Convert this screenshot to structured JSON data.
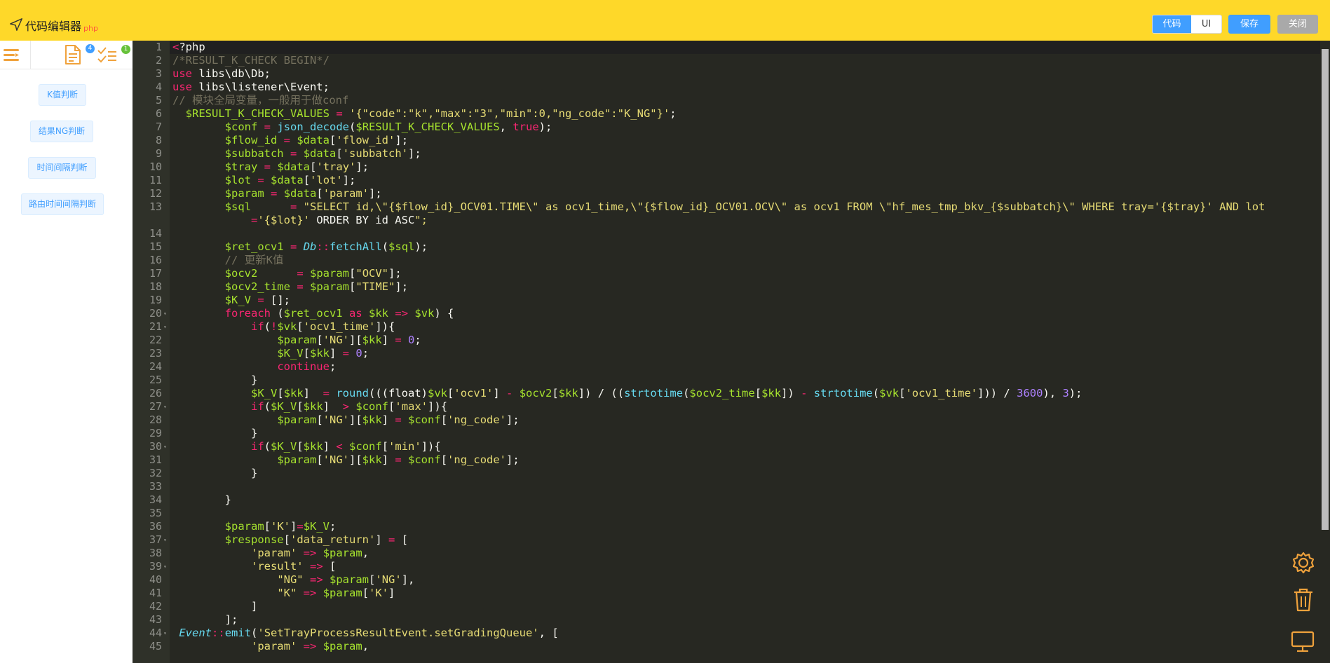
{
  "header": {
    "title": "代码编辑器",
    "lang": "php",
    "mode_tabs": [
      "代码",
      "UI"
    ],
    "save_label": "保存",
    "close_label": "关闭",
    "accent": "#409eff",
    "bar_color": "#fed829"
  },
  "sidebar": {
    "doc_badge": "4",
    "check_badge": "1",
    "items": [
      "K值判断",
      "结果NG判断",
      "时间间隔判断",
      "路由时间间隔判断"
    ]
  },
  "editor": {
    "theme_bg": "#272822",
    "lines": [
      {
        "n": "1",
        "code": "<?php"
      },
      {
        "n": "2",
        "code": "/*RESULT_K_CHECK BEGIN*/"
      },
      {
        "n": "3",
        "code": "use libs\\db\\Db;"
      },
      {
        "n": "4",
        "code": "use libs\\listener\\Event;"
      },
      {
        "n": "5",
        "code": "// 模块全局变量，一般用于做conf"
      },
      {
        "n": "6",
        "code": "  $RESULT_K_CHECK_VALUES = '{\"code\":\"k\",\"max\":\"3\",\"min\":0,\"ng_code\":\"K_NG\"}';"
      },
      {
        "n": "7",
        "code": "        $conf = json_decode($RESULT_K_CHECK_VALUES, true);"
      },
      {
        "n": "8",
        "code": "        $flow_id = $data['flow_id'];"
      },
      {
        "n": "9",
        "code": "        $subbatch = $data['subbatch'];"
      },
      {
        "n": "10",
        "code": "        $tray = $data['tray'];"
      },
      {
        "n": "11",
        "code": "        $lot = $data['lot'];"
      },
      {
        "n": "12",
        "code": "        $param = $data['param'];"
      },
      {
        "n": "13",
        "code": "        $sql      = \"SELECT id,\\\"{$flow_id}_OCV01.TIME\\\" as ocv1_time,\\\"{$flow_id}_OCV01.OCV\\\" as ocv1 FROM \\\"hf_mes_tmp_bkv_{$subbatch}\\\" WHERE tray='{$tray}' AND lot"
      },
      {
        "n": "",
        "code": "            ='{$lot}' ORDER BY id ASC\";"
      },
      {
        "n": "14",
        "code": ""
      },
      {
        "n": "15",
        "code": "        $ret_ocv1 = Db::fetchAll($sql);"
      },
      {
        "n": "16",
        "code": "        // 更新K值"
      },
      {
        "n": "17",
        "code": "        $ocv2      = $param[\"OCV\"];"
      },
      {
        "n": "18",
        "code": "        $ocv2_time = $param[\"TIME\"];"
      },
      {
        "n": "19",
        "code": "        $K_V = [];"
      },
      {
        "n": "20",
        "code": "        foreach ($ret_ocv1 as $kk => $vk) {"
      },
      {
        "n": "21",
        "code": "            if(!$vk['ocv1_time']){"
      },
      {
        "n": "22",
        "code": "                $param['NG'][$kk] = 0;"
      },
      {
        "n": "23",
        "code": "                $K_V[$kk] = 0;"
      },
      {
        "n": "24",
        "code": "                continue;"
      },
      {
        "n": "25",
        "code": "            }"
      },
      {
        "n": "26",
        "code": "            $K_V[$kk]  = round(((float)$vk['ocv1'] - $ocv2[$kk]) / ((strtotime($ocv2_time[$kk]) - strtotime($vk['ocv1_time'])) / 3600), 3);"
      },
      {
        "n": "27",
        "code": "            if($K_V[$kk]  > $conf['max']){"
      },
      {
        "n": "28",
        "code": "                $param['NG'][$kk] = $conf['ng_code'];"
      },
      {
        "n": "29",
        "code": "            }"
      },
      {
        "n": "30",
        "code": "            if($K_V[$kk] < $conf['min']){"
      },
      {
        "n": "31",
        "code": "                $param['NG'][$kk] = $conf['ng_code'];"
      },
      {
        "n": "32",
        "code": "            }"
      },
      {
        "n": "33",
        "code": ""
      },
      {
        "n": "34",
        "code": "        }"
      },
      {
        "n": "35",
        "code": ""
      },
      {
        "n": "36",
        "code": "        $param['K']=$K_V;"
      },
      {
        "n": "37",
        "code": "        $response['data_return'] = ["
      },
      {
        "n": "38",
        "code": "            'param' => $param,"
      },
      {
        "n": "39",
        "code": "            'result' => ["
      },
      {
        "n": "40",
        "code": "                \"NG\" => $param['NG'],"
      },
      {
        "n": "41",
        "code": "                \"K\" => $param['K']"
      },
      {
        "n": "42",
        "code": "            ]"
      },
      {
        "n": "43",
        "code": "        ];"
      },
      {
        "n": "44",
        "code": " Event::emit('SetTrayProcessResultEvent.setGradingQueue', ["
      },
      {
        "n": "45",
        "code": "            'param' => $param,"
      }
    ]
  },
  "floating_tools": [
    "gear-icon",
    "trash-icon",
    "monitor-icon"
  ]
}
